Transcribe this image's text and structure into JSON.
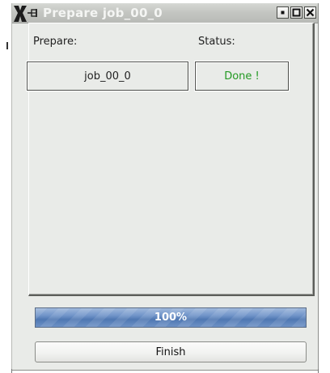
{
  "window": {
    "title": "Prepare job_00_0",
    "buttons": {
      "minimize": "minimize-icon",
      "maximize": "maximize-icon",
      "close": "close-icon"
    }
  },
  "form": {
    "prepare_label": "Prepare:",
    "status_label": "Status:",
    "job_value": "job_00_0",
    "status_value": "Done !",
    "status_color": "#229922"
  },
  "progress": {
    "text": "100%",
    "fraction": 1.0,
    "color": "#5c7fb4"
  },
  "actions": {
    "finish_label": "Finish"
  }
}
